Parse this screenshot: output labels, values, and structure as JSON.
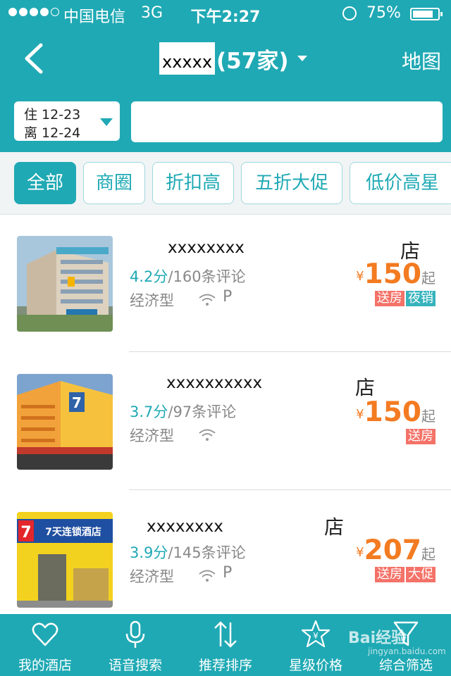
{
  "status": {
    "carrier": "中国电信",
    "network": "3G",
    "time": "下午2:27",
    "battery": "75%"
  },
  "nav": {
    "city": "xxxxx",
    "count": "(57家)",
    "map_label": "地图"
  },
  "search": {
    "checkin": "住 12-23",
    "checkout": "离 12-24",
    "query": ""
  },
  "filters": [
    "全部",
    "商圈",
    "折扣高",
    "五折大促",
    "低价高星"
  ],
  "hotels": [
    {
      "name": "xxxxxxxx",
      "suffix": "店",
      "score": "4.2分",
      "reviews": "/160条评论",
      "type": "经济型",
      "parking": "P",
      "yen": "¥",
      "price": "150",
      "qi": "起",
      "tags": [
        "送房",
        "夜销"
      ]
    },
    {
      "name": "xxxxxxxxxx",
      "suffix": "店",
      "score": "3.7分",
      "reviews": "/97条评论",
      "type": "经济型",
      "parking": "",
      "yen": "¥",
      "price": "150",
      "qi": "起",
      "tags": [
        "送房"
      ]
    },
    {
      "name": "xxxxxxxx",
      "suffix": "店",
      "score": "3.9分",
      "reviews": "/145条评论",
      "type": "经济型",
      "parking": "P",
      "yen": "¥",
      "price": "207",
      "qi": "起",
      "tags": [
        "送房",
        "大促"
      ]
    }
  ],
  "thumb_sign": "7天连锁酒店",
  "tabs": [
    "我的酒店",
    "语音搜索",
    "推荐排序",
    "星级价格",
    "综合筛选"
  ],
  "watermark": {
    "brand": "Bai经验",
    "url": "jingyan.baidu.com"
  },
  "colors": {
    "primary": "#1fa9b4",
    "price": "#f37b21",
    "tag_red": "#f47268"
  }
}
